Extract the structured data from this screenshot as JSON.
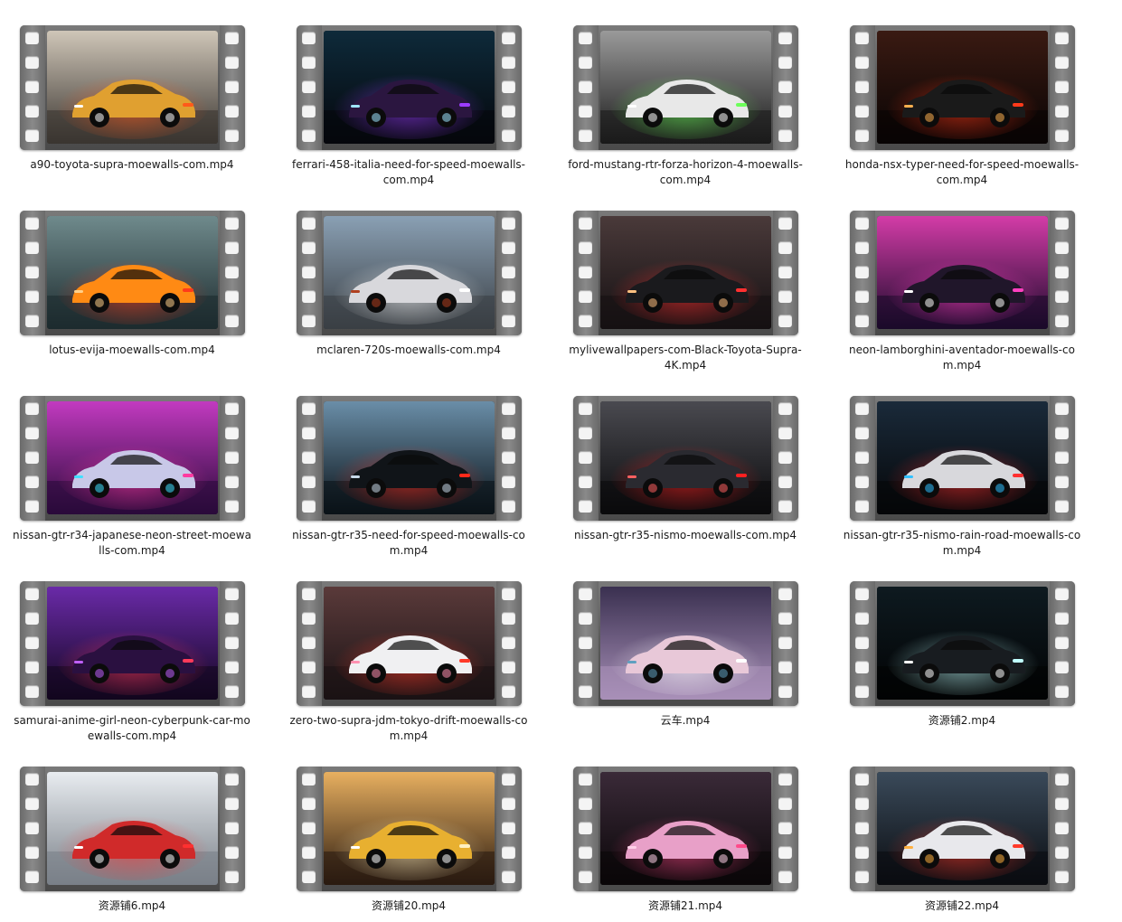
{
  "files": [
    {
      "name": "a90-toyota-supra-moewalls-com.mp4",
      "thumb": {
        "bg": [
          "#cfc6b8",
          "#3a3530"
        ],
        "car": "#e0a030",
        "glow": "#ff5a1a",
        "accent": "#ffffff"
      }
    },
    {
      "name": "ferrari-458-italia-need-for-speed-moewalls-com.mp4",
      "thumb": {
        "bg": [
          "#0e2a3a",
          "#05070c"
        ],
        "car": "#2b1640",
        "glow": "#9c3cff",
        "accent": "#9fe6ff"
      }
    },
    {
      "name": "ford-mustang-rtr-forza-horizon-4-moewalls-com.mp4",
      "thumb": {
        "bg": [
          "#9a9a9a",
          "#1a1a1a"
        ],
        "car": "#e8e8e8",
        "glow": "#6cff5a",
        "accent": "#ffffff"
      }
    },
    {
      "name": "honda-nsx-typer-need-for-speed-moewalls-com.mp4",
      "thumb": {
        "bg": [
          "#3a1a12",
          "#080404"
        ],
        "car": "#1a1a1a",
        "glow": "#ff3a1a",
        "accent": "#ffb050"
      }
    },
    {
      "name": "lotus-evija-moewalls-com.mp4",
      "thumb": {
        "bg": [
          "#6f8a8c",
          "#1d2b2e"
        ],
        "car": "#ff8a14",
        "glow": "#ff3a1a",
        "accent": "#ffd08a"
      }
    },
    {
      "name": "mclaren-720s-moewalls-com.mp4",
      "thumb": {
        "bg": [
          "#8aa0b4",
          "#3a3f44"
        ],
        "car": "#d8d8dc",
        "glow": "#ffffff",
        "accent": "#b04020"
      }
    },
    {
      "name": "mylivewallpapers-com-Black-Toyota-Supra-4K.mp4",
      "thumb": {
        "bg": [
          "#4a3a3a",
          "#151012"
        ],
        "car": "#1a1a1d",
        "glow": "#ff3030",
        "accent": "#ffc080"
      }
    },
    {
      "name": "neon-lamborghini-aventador-moewalls-com.mp4",
      "thumb": {
        "bg": [
          "#d43ca8",
          "#1a0a2a"
        ],
        "car": "#20162a",
        "glow": "#ff40c0",
        "accent": "#ffffff"
      }
    },
    {
      "name": "nissan-gtr-r34-japanese-neon-street-moewalls-com.mp4",
      "thumb": {
        "bg": [
          "#c23ac0",
          "#2a0a3a"
        ],
        "car": "#c8c8e8",
        "glow": "#ff3aa0",
        "accent": "#40e0ff"
      }
    },
    {
      "name": "nissan-gtr-r35-need-for-speed-moewalls-com.mp4",
      "thumb": {
        "bg": [
          "#6a8ea8",
          "#0a1218"
        ],
        "car": "#101418",
        "glow": "#ff2a1a",
        "accent": "#c8d8e8"
      }
    },
    {
      "name": "nissan-gtr-r35-nismo-moewalls-com.mp4",
      "thumb": {
        "bg": [
          "#4a4a50",
          "#0a0a0c"
        ],
        "car": "#2a2a30",
        "glow": "#ff2020",
        "accent": "#ff6060"
      }
    },
    {
      "name": "nissan-gtr-r35-nismo-rain-road-moewalls-com.mp4",
      "thumb": {
        "bg": [
          "#1a2a3a",
          "#050608"
        ],
        "car": "#d8d8dc",
        "glow": "#ff3030",
        "accent": "#30c0ff"
      }
    },
    {
      "name": "samurai-anime-girl-neon-cyberpunk-car-moewalls-com.mp4",
      "thumb": {
        "bg": [
          "#6a2aa8",
          "#12061e"
        ],
        "car": "#2a1040",
        "glow": "#ff3a5a",
        "accent": "#c060ff"
      }
    },
    {
      "name": "zero-two-supra-jdm-tokyo-drift-moewalls-com.mp4",
      "thumb": {
        "bg": [
          "#5a3a3a",
          "#1a1214"
        ],
        "car": "#f0f0f2",
        "glow": "#ff3a2a",
        "accent": "#ff90b0"
      }
    },
    {
      "name": "云车.mp4",
      "thumb": {
        "bg": [
          "#3a3050",
          "#a890b8"
        ],
        "car": "#e8c8d8",
        "glow": "#ffffff",
        "accent": "#60a0c0"
      }
    },
    {
      "name": "资源铺2.mp4",
      "thumb": {
        "bg": [
          "#0e1a20",
          "#020304"
        ],
        "car": "#181c20",
        "glow": "#c0ffff",
        "accent": "#ffffff"
      }
    },
    {
      "name": "资源铺6.mp4",
      "thumb": {
        "bg": [
          "#e8ecf0",
          "#7a8088"
        ],
        "car": "#d02a2a",
        "glow": "#ff3030",
        "accent": "#ffffff"
      }
    },
    {
      "name": "资源铺20.mp4",
      "thumb": {
        "bg": [
          "#e8b060",
          "#2a1a10"
        ],
        "car": "#e8b030",
        "glow": "#fff0c0",
        "accent": "#ffffff"
      }
    },
    {
      "name": "资源铺21.mp4",
      "thumb": {
        "bg": [
          "#3a2a38",
          "#0a0608"
        ],
        "car": "#e8a0c8",
        "glow": "#ff4a8a",
        "accent": "#ffd0e8"
      }
    },
    {
      "name": "资源铺22.mp4",
      "thumb": {
        "bg": [
          "#3a4a5a",
          "#0a0c10"
        ],
        "car": "#e8e8ec",
        "glow": "#ff3a2a",
        "accent": "#ffb040"
      }
    }
  ],
  "icons": {
    "thumbnail": "video-film-strip-icon"
  }
}
